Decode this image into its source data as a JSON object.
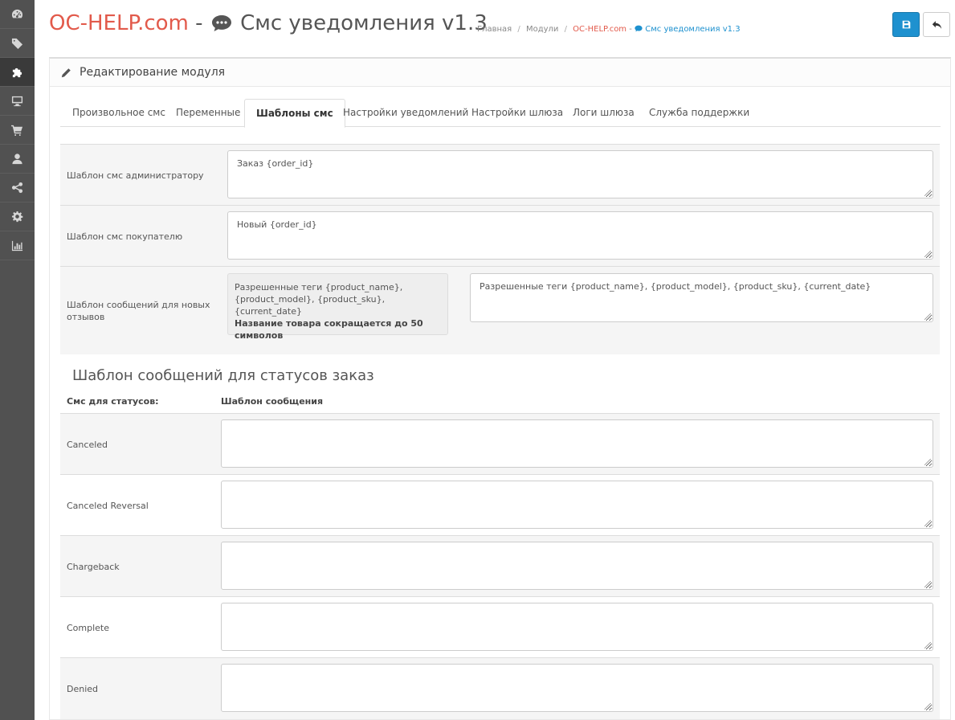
{
  "sidebar": {
    "items": [
      {
        "icon": "dashboard-icon",
        "active": false
      },
      {
        "icon": "tags-icon",
        "active": false
      },
      {
        "icon": "puzzle-icon",
        "active": true
      },
      {
        "icon": "desktop-icon",
        "active": false
      },
      {
        "icon": "shopping-cart-icon",
        "active": false
      },
      {
        "icon": "user-icon",
        "active": false
      },
      {
        "icon": "share-icon",
        "active": false
      },
      {
        "icon": "gear-icon",
        "active": false
      },
      {
        "icon": "bar-chart-icon",
        "active": false
      }
    ]
  },
  "header": {
    "brand": "OC-HELP.com",
    "separator": "-",
    "module_title": "Смс уведомления v1.3",
    "breadcrumbs": {
      "home": "Главная",
      "modules": "Модули",
      "brand": "OC-HELP.com",
      "dash": "-",
      "module": "Смс уведомления v1.3"
    }
  },
  "panel": {
    "heading": "Редактирование модуля",
    "tabs": [
      {
        "label": "Произвольное смс",
        "active": false
      },
      {
        "label": "Переменные",
        "active": false
      },
      {
        "label": "Шаблоны смс",
        "active": true
      },
      {
        "label": "Настройки уведомлений",
        "active": false
      },
      {
        "label": "Настройки шлюза",
        "active": false
      },
      {
        "label": "Логи шлюза",
        "active": false
      },
      {
        "label": "Служба поддержки",
        "active": false
      }
    ],
    "templates": {
      "admin": {
        "label": "Шаблон смс администратору",
        "value": "Заказ {order_id}"
      },
      "customer": {
        "label": "Шаблон смс покупателю",
        "value": "Новый {order_id}"
      },
      "reviews": {
        "label": "Шаблон сообщений для новых отзывов",
        "hint_text": "Разрешенные теги {product_name}, {product_model}, {product_sku}, {current_date}",
        "hint_bold": "Название товара сокращается до 50 символов",
        "value": "Разрешенные теги {product_name}, {product_model}, {product_sku}, {current_date}"
      }
    },
    "status_section": {
      "title": "Шаблон сообщений для статусов заказ",
      "col_status": "Смс для статусов:",
      "col_template": "Шаблон сообщения",
      "statuses": [
        {
          "name": "Canceled",
          "value": ""
        },
        {
          "name": "Canceled Reversal",
          "value": ""
        },
        {
          "name": "Chargeback",
          "value": ""
        },
        {
          "name": "Complete",
          "value": ""
        },
        {
          "name": "Denied",
          "value": ""
        }
      ]
    }
  },
  "colors": {
    "brand": "#e25a4b",
    "primary": "#1e91cf",
    "sidebar": "#515151"
  }
}
